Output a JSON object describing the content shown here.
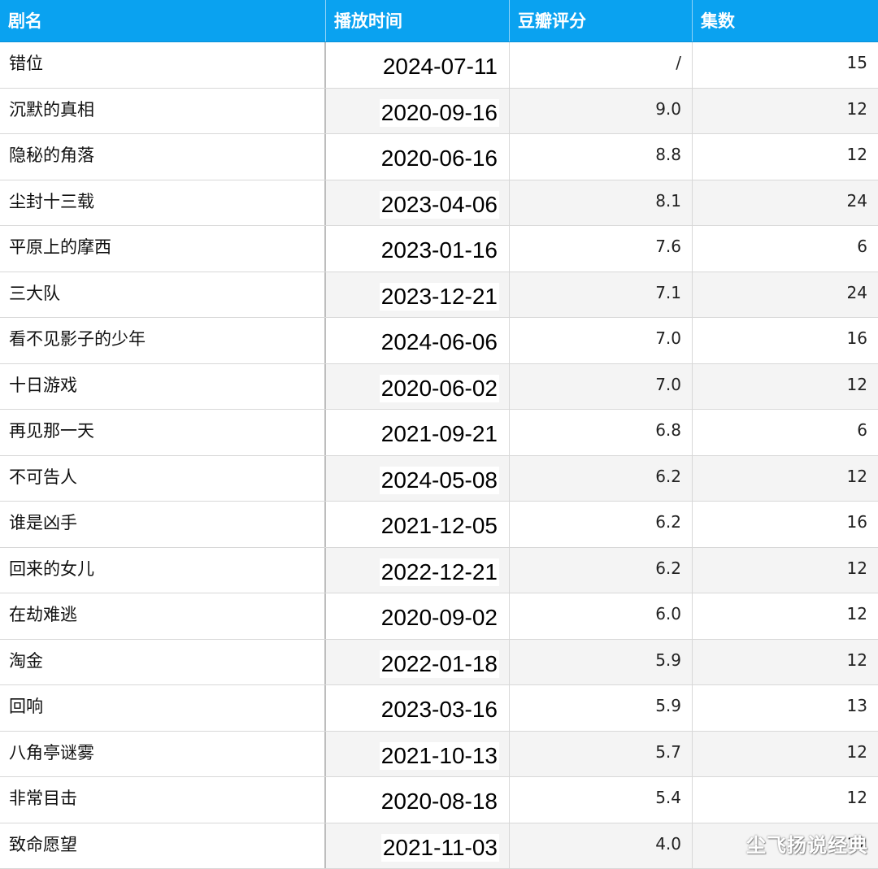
{
  "table": {
    "headers": [
      "剧名",
      "播放时间",
      "豆瓣评分",
      "集数"
    ],
    "rows": [
      [
        "错位",
        "2024-07-11",
        "/",
        "15"
      ],
      [
        "沉默的真相",
        "2020-09-16",
        "9.0",
        "12"
      ],
      [
        "隐秘的角落",
        "2020-06-16",
        "8.8",
        "12"
      ],
      [
        "尘封十三载",
        "2023-04-06",
        "8.1",
        "24"
      ],
      [
        "平原上的摩西",
        "2023-01-16",
        "7.6",
        "6"
      ],
      [
        "三大队",
        "2023-12-21",
        "7.1",
        "24"
      ],
      [
        "看不见影子的少年",
        "2024-06-06",
        "7.0",
        "16"
      ],
      [
        "十日游戏",
        "2020-06-02",
        "7.0",
        "12"
      ],
      [
        "再见那一天",
        "2021-09-21",
        "6.8",
        "6"
      ],
      [
        "不可告人",
        "2024-05-08",
        "6.2",
        "12"
      ],
      [
        "谁是凶手",
        "2021-12-05",
        "6.2",
        "16"
      ],
      [
        "回来的女儿",
        "2022-12-21",
        "6.2",
        "12"
      ],
      [
        "在劫难逃",
        "2020-09-02",
        "6.0",
        "12"
      ],
      [
        "淘金",
        "2022-01-18",
        "5.9",
        "12"
      ],
      [
        "回响",
        "2023-03-16",
        "5.9",
        "13"
      ],
      [
        "八角亭谜雾",
        "2021-10-13",
        "5.7",
        "12"
      ],
      [
        "非常目击",
        "2020-08-18",
        "5.4",
        "12"
      ],
      [
        "致命愿望",
        "2021-11-03",
        "4.0",
        "12"
      ]
    ]
  },
  "watermark": "尘飞扬说经典",
  "colors": {
    "header_bg": "#0aa2f0",
    "header_text": "#ffffff",
    "alt_row_bg": "#f4f4f4",
    "grid_line": "#d8d8d8"
  }
}
